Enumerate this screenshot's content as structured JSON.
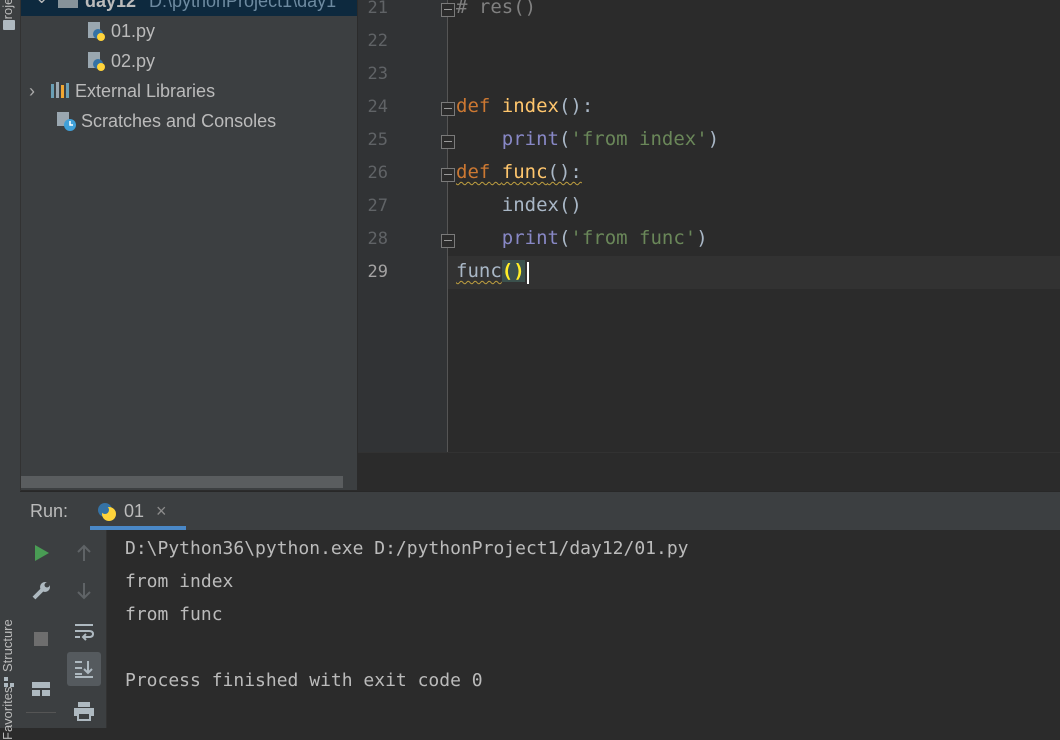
{
  "sidebar_tabs": {
    "project": "Project",
    "structure": "Structure",
    "favorites": "Favorites"
  },
  "project_tree": {
    "root_name": "day12",
    "root_path": "D:\\pythonProject1\\day1",
    "files": [
      "01.py",
      "02.py"
    ],
    "external_libraries": "External Libraries",
    "scratches": "Scratches and Consoles"
  },
  "editor": {
    "line_numbers": [
      "21",
      "22",
      "23",
      "24",
      "25",
      "26",
      "27",
      "28",
      "29"
    ],
    "code": {
      "l21": "# res()",
      "l24_kw": "def",
      "l24_fn": "index",
      "l24_rest": "():",
      "l25_builtin": "print",
      "l25_open": "(",
      "l25_str": "'from index'",
      "l25_close": ")",
      "l26_kw": "def",
      "l26_fn": "func",
      "l26_rest": "():",
      "l27": "index()",
      "l28_builtin": "print",
      "l28_open": "(",
      "l28_str": "'from func'",
      "l28_close": ")",
      "l29_name": "func",
      "l29_parens": "()"
    }
  },
  "run_panel": {
    "label": "Run:",
    "tab_name": "01",
    "tab_close": "×",
    "console_lines": [
      "D:\\Python36\\python.exe D:/pythonProject1/day12/01.py",
      "from index",
      "from func",
      "",
      "Process finished with exit code 0"
    ]
  },
  "colors": {
    "keyword": "#cc7832",
    "function_name": "#ffc66d",
    "string": "#6a8759",
    "builtin": "#8888c6",
    "run_green": "#499c54"
  },
  "icons": [
    "python-file-icon",
    "libraries-icon",
    "scratches-icon",
    "run-icon",
    "wrench-icon",
    "stop-icon",
    "layout-icon",
    "arrow-up-icon",
    "arrow-down-icon",
    "soft-wrap-icon",
    "scroll-to-end-icon",
    "print-icon",
    "python-icon",
    "close-icon"
  ]
}
